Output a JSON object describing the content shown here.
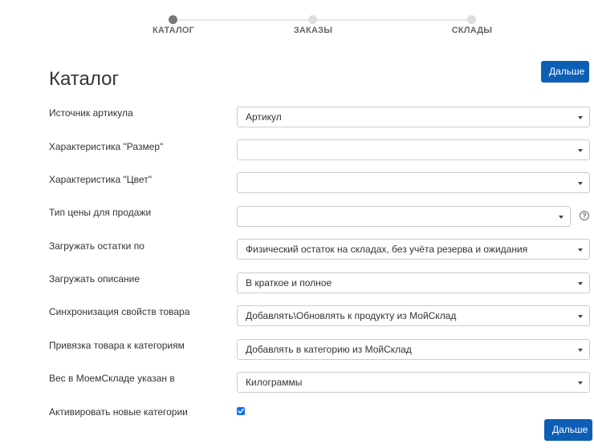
{
  "stepper": {
    "steps": [
      {
        "label": "КАТАЛОГ",
        "active": true
      },
      {
        "label": "ЗАКАЗЫ",
        "active": false
      },
      {
        "label": "СКЛАДЫ",
        "active": false
      }
    ]
  },
  "page": {
    "title": "Каталог",
    "next_button_top": "Дальше",
    "next_button_bottom": "Дальше"
  },
  "form": {
    "fields": [
      {
        "label": "Источник артикула",
        "value": "Артикул"
      },
      {
        "label": "Характеристика \"Размер\"",
        "value": ""
      },
      {
        "label": "Характеристика \"Цвет\"",
        "value": ""
      },
      {
        "label": "Тип цены для продажи",
        "value": ""
      },
      {
        "label": "Загружать остатки по",
        "value": "Физический остаток на складах, без учёта резерва и ожидания"
      },
      {
        "label": "Загружать описание",
        "value": "В краткое и полное"
      },
      {
        "label": "Синхронизация свойств товара",
        "value": "Добавлять\\Обновлять к продукту из МойСклад"
      },
      {
        "label": "Привязка товара к категориям",
        "value": "Добавлять в категорию из МойСклад"
      },
      {
        "label": "Вес в МоемСкладе указан в",
        "value": "Килограммы"
      }
    ],
    "checkbox": {
      "label": "Активировать новые категории",
      "checked": true
    },
    "help_icon_glyph": "?"
  },
  "colors": {
    "primary": "#0d5fb5",
    "checkbox": "#0d6efd",
    "step_active": "#777777",
    "step_inactive": "#dddddd"
  }
}
